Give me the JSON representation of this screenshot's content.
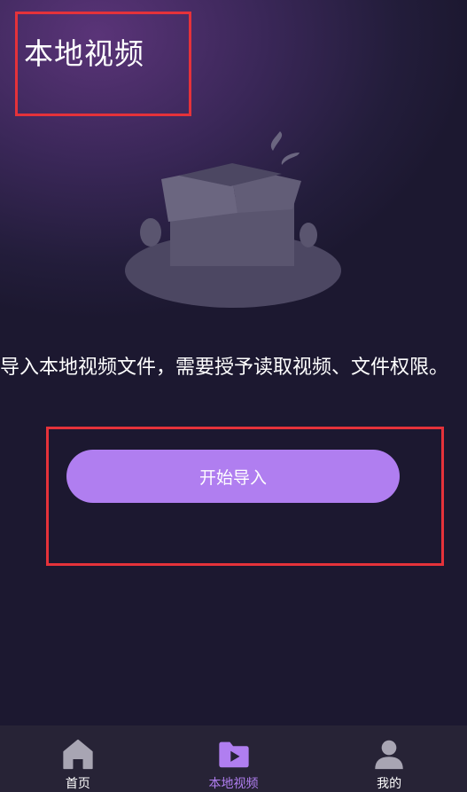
{
  "header": {
    "title": "本地视频"
  },
  "empty_state": {
    "illustration_icon": "open-box-icon",
    "description": "导入本地视频文件，需要授予读取视频、文件权限。"
  },
  "actions": {
    "start_import_label": "开始导入"
  },
  "tabbar": {
    "active_color": "#b07ef0",
    "items": [
      {
        "label": "首页",
        "icon": "home-icon"
      },
      {
        "label": "本地视频",
        "icon": "video-folder-icon"
      },
      {
        "label": "我的",
        "icon": "user-icon"
      }
    ]
  },
  "colors": {
    "background": "#1c1830",
    "accent": "#b07ef0",
    "highlight": "#e5323a"
  }
}
